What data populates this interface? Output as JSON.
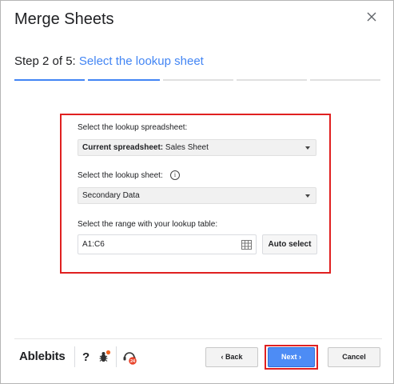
{
  "dialog": {
    "title": "Merge Sheets",
    "close_icon": "close-icon"
  },
  "step": {
    "number_text": "Step 2 of 5:",
    "name": "Select the lookup sheet",
    "current": 2,
    "total": 5,
    "colors": {
      "done": "#4285f4",
      "current": "#4285f4",
      "todo": "#e0e0e0"
    }
  },
  "form": {
    "spreadsheet_label": "Select the lookup spreadsheet:",
    "spreadsheet_prefix": "Current spreadsheet:",
    "spreadsheet_value": "Sales Sheet",
    "sheet_label": "Select the lookup sheet:",
    "sheet_info_icon": "info-icon",
    "sheet_value": "Secondary Data",
    "range_label": "Select the range with your lookup table:",
    "range_value": "A1:C6",
    "range_icon": "grid-icon",
    "auto_select_label": "Auto select"
  },
  "footer": {
    "logo": "Ablebits",
    "help_label": "?",
    "bug_icon": "bug-icon",
    "support_icon": "support-icon",
    "support_badge": "24",
    "back_label": "Back",
    "next_label": "Next",
    "cancel_label": "Cancel",
    "accent_color": "#4d8cf5",
    "highlight_color": "#e02020"
  }
}
